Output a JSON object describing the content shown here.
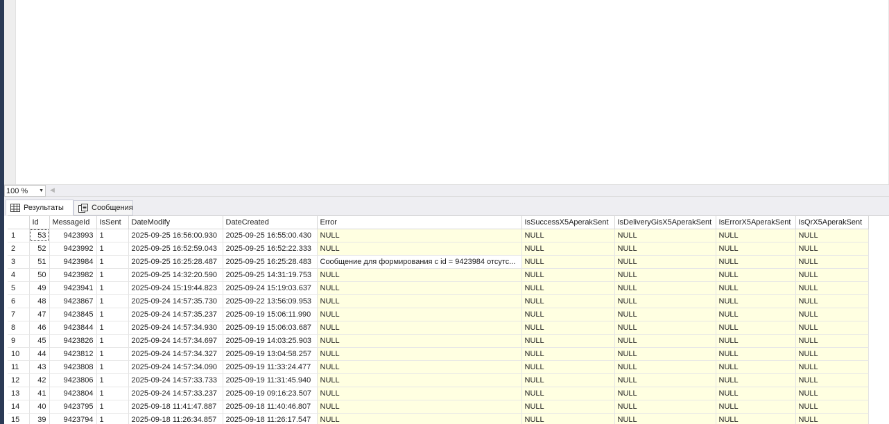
{
  "zoom": {
    "value": "100 %"
  },
  "tabs": [
    {
      "label": "Результаты",
      "icon": "grid-icon",
      "active": true
    },
    {
      "label": "Сообщения",
      "icon": "messages-icon",
      "active": false
    }
  ],
  "grid": {
    "columns": [
      "",
      "Id",
      "MessageId",
      "IsSent",
      "DateModify",
      "DateCreated",
      "Error",
      "IsSuccessX5AperakSent",
      "IsDeliveryGisX5AperakSent",
      "IsErrorX5AperakSent",
      "IsQrX5AperakSent"
    ],
    "rows": [
      [
        "1",
        "53",
        "9423993",
        "1",
        "2025-09-25 16:56:00.930",
        "2025-09-25 16:55:00.430",
        "NULL",
        "NULL",
        "NULL",
        "NULL",
        "NULL"
      ],
      [
        "2",
        "52",
        "9423992",
        "1",
        "2025-09-25 16:52:59.043",
        "2025-09-25 16:52:22.333",
        "NULL",
        "NULL",
        "NULL",
        "NULL",
        "NULL"
      ],
      [
        "3",
        "51",
        "9423984",
        "1",
        "2025-09-25 16:25:28.487",
        "2025-09-25 16:25:28.483",
        "Сообщение для формирования с id = 9423984 отсутс...",
        "NULL",
        "NULL",
        "NULL",
        "NULL"
      ],
      [
        "4",
        "50",
        "9423982",
        "1",
        "2025-09-25 14:32:20.590",
        "2025-09-25 14:31:19.753",
        "NULL",
        "NULL",
        "NULL",
        "NULL",
        "NULL"
      ],
      [
        "5",
        "49",
        "9423941",
        "1",
        "2025-09-24 15:19:44.823",
        "2025-09-24 15:19:03.637",
        "NULL",
        "NULL",
        "NULL",
        "NULL",
        "NULL"
      ],
      [
        "6",
        "48",
        "9423867",
        "1",
        "2025-09-24 14:57:35.730",
        "2025-09-22 13:56:09.953",
        "NULL",
        "NULL",
        "NULL",
        "NULL",
        "NULL"
      ],
      [
        "7",
        "47",
        "9423845",
        "1",
        "2025-09-24 14:57:35.237",
        "2025-09-19 15:06:11.990",
        "NULL",
        "NULL",
        "NULL",
        "NULL",
        "NULL"
      ],
      [
        "8",
        "46",
        "9423844",
        "1",
        "2025-09-24 14:57:34.930",
        "2025-09-19 15:06:03.687",
        "NULL",
        "NULL",
        "NULL",
        "NULL",
        "NULL"
      ],
      [
        "9",
        "45",
        "9423826",
        "1",
        "2025-09-24 14:57:34.697",
        "2025-09-19 14:03:25.903",
        "NULL",
        "NULL",
        "NULL",
        "NULL",
        "NULL"
      ],
      [
        "10",
        "44",
        "9423812",
        "1",
        "2025-09-24 14:57:34.327",
        "2025-09-19 13:04:58.257",
        "NULL",
        "NULL",
        "NULL",
        "NULL",
        "NULL"
      ],
      [
        "11",
        "43",
        "9423808",
        "1",
        "2025-09-24 14:57:34.090",
        "2025-09-19 11:33:24.477",
        "NULL",
        "NULL",
        "NULL",
        "NULL",
        "NULL"
      ],
      [
        "12",
        "42",
        "9423806",
        "1",
        "2025-09-24 14:57:33.733",
        "2025-09-19 11:31:45.940",
        "NULL",
        "NULL",
        "NULL",
        "NULL",
        "NULL"
      ],
      [
        "13",
        "41",
        "9423804",
        "1",
        "2025-09-24 14:57:33.237",
        "2025-09-19 09:16:23.507",
        "NULL",
        "NULL",
        "NULL",
        "NULL",
        "NULL"
      ],
      [
        "14",
        "40",
        "9423795",
        "1",
        "2025-09-18 11:41:47.887",
        "2025-09-18 11:40:46.807",
        "NULL",
        "NULL",
        "NULL",
        "NULL",
        "NULL"
      ],
      [
        "15",
        "39",
        "9423794",
        "1",
        "2025-09-18 11:26:34.857",
        "2025-09-18 11:26:17.547",
        "NULL",
        "NULL",
        "NULL",
        "NULL",
        "NULL"
      ]
    ]
  },
  "colors": {
    "null_cell": "#ffffe1",
    "left_strip": "#2b3a55"
  }
}
